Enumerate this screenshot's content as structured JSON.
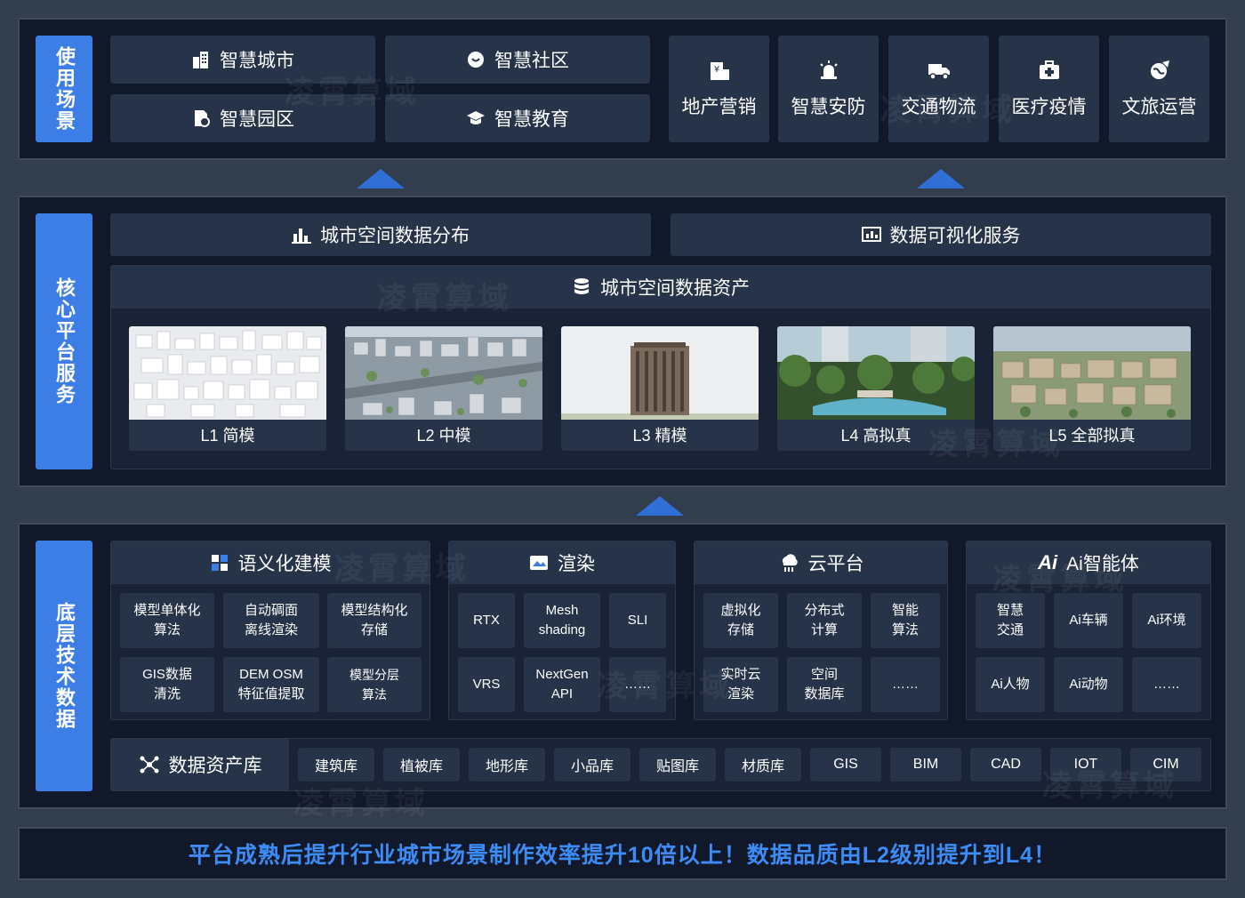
{
  "top": {
    "label": "使用场景",
    "pairs": [
      "智慧城市",
      "智慧社区",
      "智慧园区",
      "智慧教育"
    ],
    "tiles": [
      "地产营销",
      "智慧安防",
      "交通物流",
      "医疗疫情",
      "文旅运营"
    ]
  },
  "middle": {
    "label": "核心平台服务",
    "services": [
      "城市空间数据分布",
      "数据可视化服务"
    ],
    "assets_title": "城市空间数据资产",
    "levels": [
      "L1 简模",
      "L2 中模",
      "L3 精模",
      "L4 高拟真",
      "L5 全部拟真"
    ]
  },
  "bottom": {
    "label": "底层技术数据",
    "modeling": {
      "title": "语义化建模",
      "cells": [
        "模型单体化\n算法",
        "自动碉面\n离线渲染",
        "模型结构化\n存储",
        "GIS数据\n清洗",
        "DEM OSM\n特征值提取",
        "模型分层\n算法"
      ]
    },
    "render": {
      "title": "渲染",
      "cells": [
        "RTX",
        "Mesh\nshading",
        "SLI",
        "VRS",
        "NextGen\nAPI",
        "……"
      ]
    },
    "cloud": {
      "title": "云平台",
      "cells": [
        "虚拟化\n存储",
        "分布式\n计算",
        "智能\n算法",
        "实时云\n渲染",
        "空间\n数据库",
        "……"
      ]
    },
    "ai": {
      "title": "Ai智能体",
      "icon_text": "Ai",
      "cells": [
        "智慧\n交通",
        "Ai车辆",
        "Ai环境",
        "Ai人物",
        "Ai动物",
        "……"
      ]
    },
    "library": {
      "title": "数据资产库",
      "chips": [
        "建筑库",
        "植被库",
        "地形库",
        "小品库",
        "贴图库",
        "材质库",
        "GIS",
        "BIM",
        "CAD",
        "IOT",
        "CIM"
      ]
    }
  },
  "footer": "平台成熟后提升行业城市场景制作效率提升10倍以上！数据品质由L2级别提升到L4！",
  "watermark": "凌霄算域",
  "colors": {
    "accent": "#3d7ee6",
    "panel": "#10182a",
    "tile": "#263349",
    "footer_text": "#3d8bf5"
  }
}
